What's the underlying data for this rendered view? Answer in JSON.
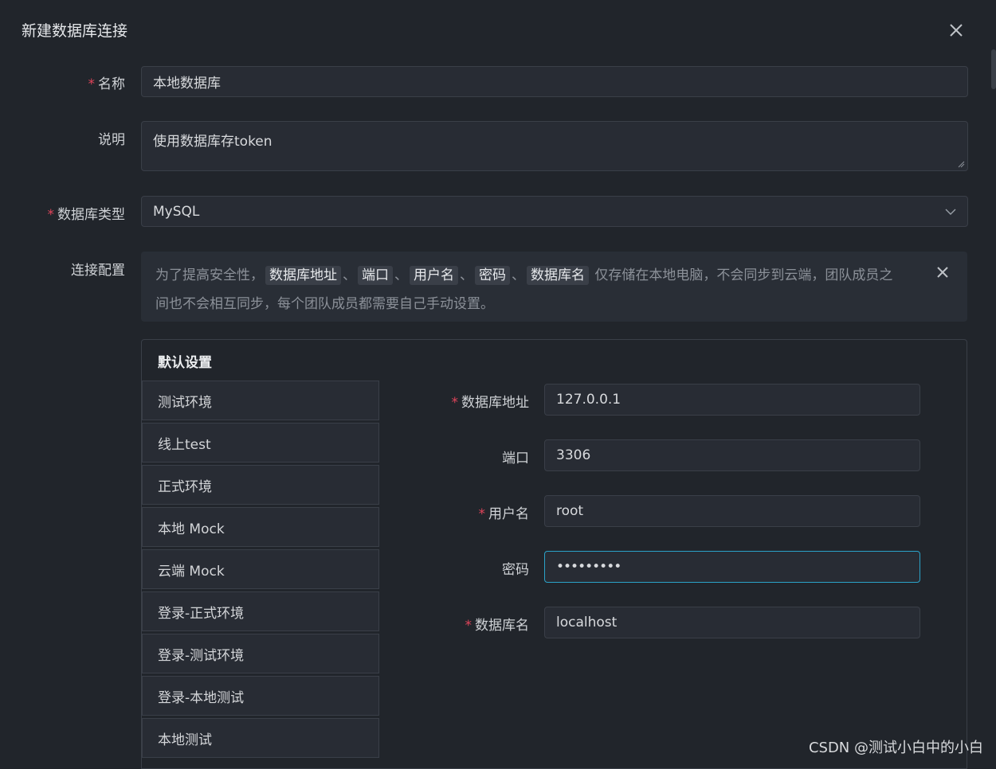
{
  "dialog": {
    "title": "新建数据库连接"
  },
  "form": {
    "name": {
      "label": "名称",
      "required": true,
      "value": "本地数据库"
    },
    "description": {
      "label": "说明",
      "value": "使用数据库存token"
    },
    "db_type": {
      "label": "数据库类型",
      "required": true,
      "value": "MySQL"
    },
    "connection": {
      "label": "连接配置"
    }
  },
  "notice": {
    "prefix": "为了提高安全性，",
    "tags": [
      "数据库地址",
      "端口",
      "用户名",
      "密码",
      "数据库名"
    ],
    "separator": "、",
    "suffix_line1": "仅存储在本地电脑，不会同步到云端，团队成员之",
    "suffix_line2": "间也不会相互同步，每个团队成员都需要自己手动设置。"
  },
  "env_panel": {
    "title": "默认设置",
    "items": [
      "测试环境",
      "线上test",
      "正式环境",
      "本地 Mock",
      "云端 Mock",
      "登录-正式环境",
      "登录-测试环境",
      "登录-本地测试",
      "本地测试"
    ]
  },
  "db_form": {
    "host": {
      "label": "数据库地址",
      "required": true,
      "value": "127.0.0.1"
    },
    "port": {
      "label": "端口",
      "value": "3306"
    },
    "username": {
      "label": "用户名",
      "required": true,
      "value": "root"
    },
    "password": {
      "label": "密码",
      "value": "•••••••••"
    },
    "database": {
      "label": "数据库名",
      "required": true,
      "value": "localhost"
    }
  },
  "watermark": "CSDN @测试小白中的小白",
  "colors": {
    "background": "#21252b",
    "input_bg": "#282c34",
    "border": "#3a3f48",
    "required": "#e0445a",
    "focus": "#2ba3c9"
  }
}
